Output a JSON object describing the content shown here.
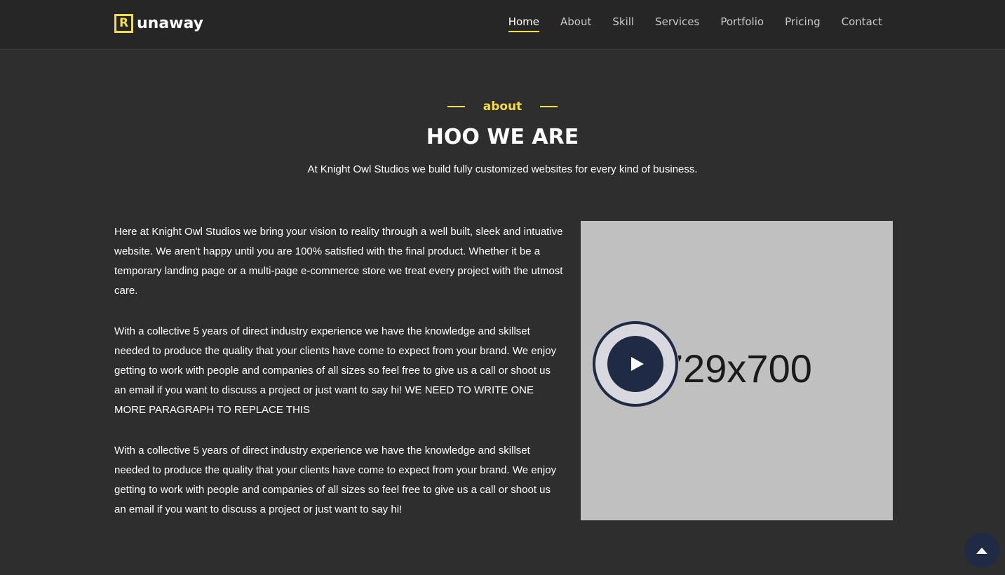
{
  "brand": {
    "mark": "R",
    "name": "unaway"
  },
  "nav": {
    "items": [
      {
        "label": "Home",
        "active": true
      },
      {
        "label": "About"
      },
      {
        "label": "Skill"
      },
      {
        "label": "Services"
      },
      {
        "label": "Portfolio"
      },
      {
        "label": "Pricing"
      },
      {
        "label": "Contact"
      }
    ]
  },
  "about": {
    "tag": "about",
    "title": "HOO WE ARE",
    "subtitle": "At Knight Owl Studios we build fully customized websites for every kind of business.",
    "paragraphs": [
      "Here at Knight Owl Studios we bring your vision to reality through a well built, sleek and intuative website. We aren't happy until you are 100% satisfied with the final product. Whether it be a temporary landing page or a multi-page e-commerce store we treat every project with the utmost care.",
      "With a collective 5 years of direct industry experience we have the knowledge and skillset needed to produce the quality that your clients have come to expect from your brand. We enjoy getting to work with people and companies of all sizes so feel free to give us a call or shoot us an email if you want to discuss a project or just want to say hi! WE NEED TO WRITE ONE MORE PARAGRAPH TO REPLACE THIS",
      "With a collective 5 years of direct industry experience we have the knowledge and skillset needed to produce the quality that your clients have come to expect from your brand. We enjoy getting to work with people and companies of all sizes so feel free to give us a call or shoot us an email if you want to discuss a project or just want to say hi!"
    ],
    "media": {
      "placeholder_text": "729x700",
      "play_icon": "play-icon"
    }
  },
  "back_to_top": {
    "icon": "arrow-up-icon"
  },
  "colors": {
    "accent": "#f5dd42",
    "background": "#2e2e2e",
    "navbar": "#262626",
    "play_button": "#1f2a44"
  }
}
